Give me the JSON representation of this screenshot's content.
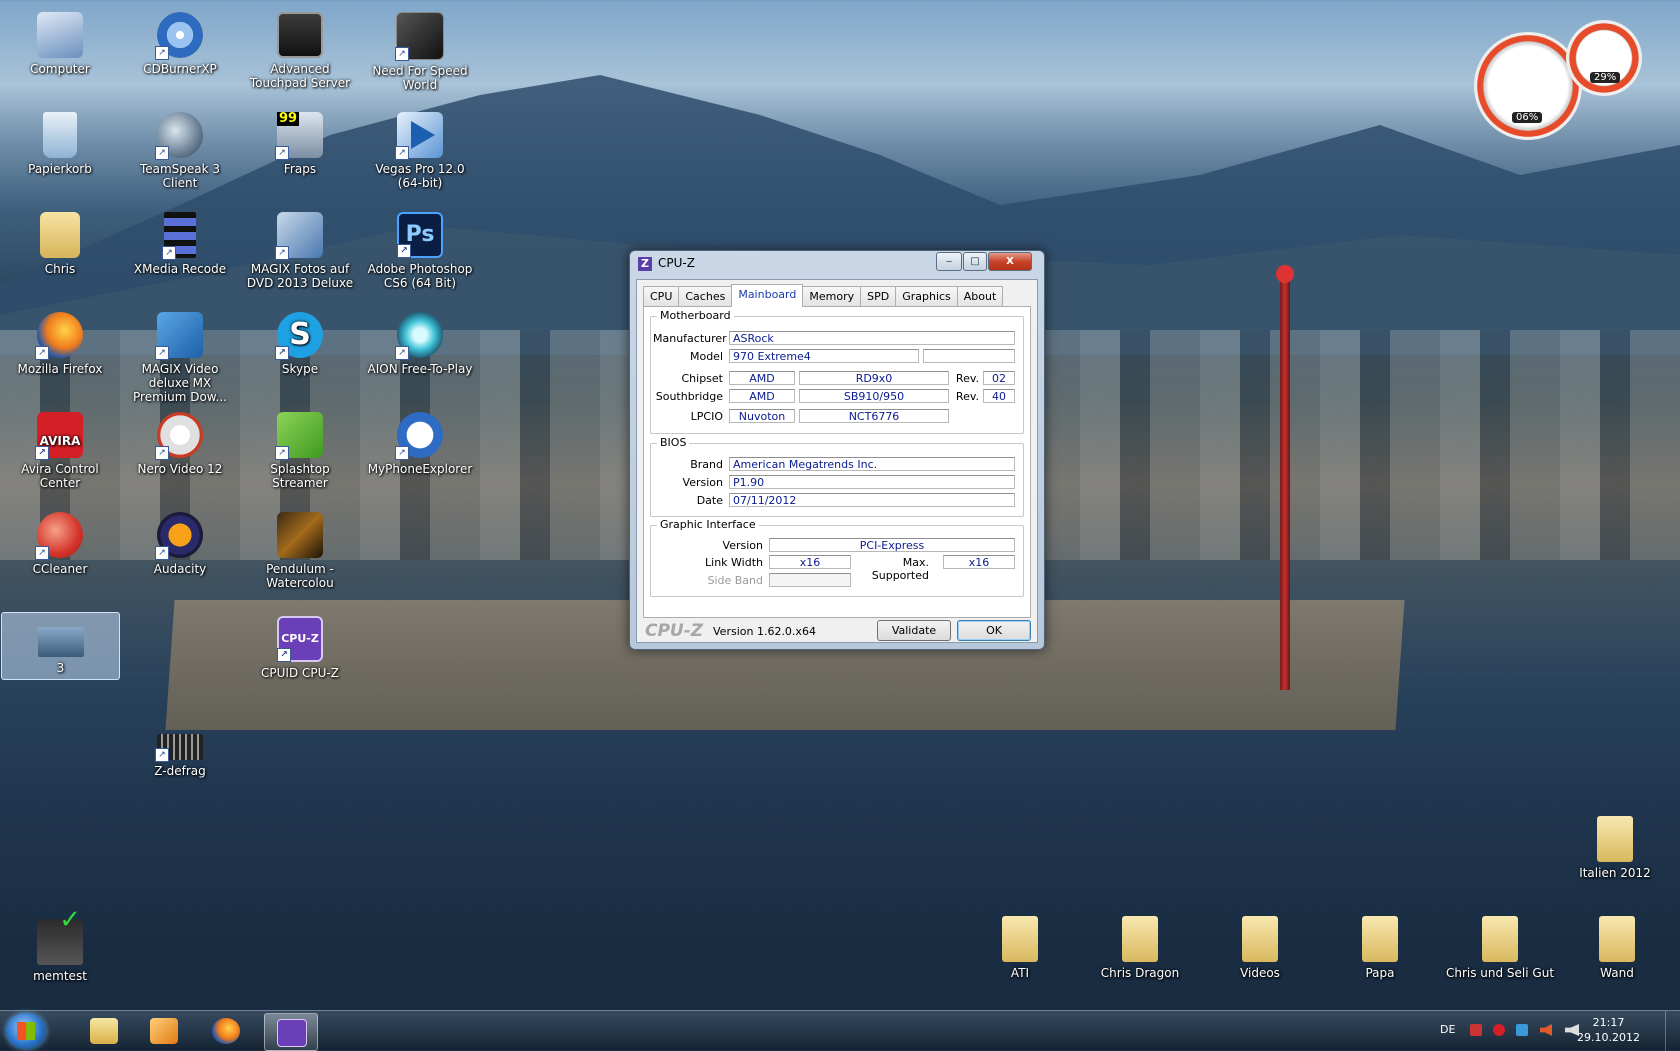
{
  "desktop": {
    "icons": [
      {
        "label": "Computer"
      },
      {
        "label": "CDBurnerXP"
      },
      {
        "label": "Advanced Touchpad Server"
      },
      {
        "label": "Need For Speed World"
      },
      {
        "label": "Papierkorb"
      },
      {
        "label": "TeamSpeak 3 Client"
      },
      {
        "label": "Fraps"
      },
      {
        "label": "Vegas Pro 12.0 (64-bit)"
      },
      {
        "label": "Chris"
      },
      {
        "label": "XMedia Recode"
      },
      {
        "label": "MAGIX Fotos auf DVD 2013 Deluxe"
      },
      {
        "label": "Adobe Photoshop CS6 (64 Bit)"
      },
      {
        "label": "Mozilla Firefox"
      },
      {
        "label": "MAGIX Video deluxe MX Premium Dow..."
      },
      {
        "label": "Skype"
      },
      {
        "label": "AION Free-To-Play"
      },
      {
        "label": "Avira Control Center"
      },
      {
        "label": "Nero Video 12"
      },
      {
        "label": "Splashtop Streamer"
      },
      {
        "label": "MyPhoneExplorer"
      },
      {
        "label": "CCleaner"
      },
      {
        "label": "Audacity"
      },
      {
        "label": "Pendulum - Watercolou"
      },
      {
        "label": "3"
      },
      {
        "label": "CPUID CPU-Z"
      },
      {
        "label": "Z-defrag"
      },
      {
        "label": "memtest"
      },
      {
        "label": "Italien 2012"
      },
      {
        "label": "ATI"
      },
      {
        "label": "Chris Dragon"
      },
      {
        "label": "Videos"
      },
      {
        "label": "Papa"
      },
      {
        "label": "Chris und Seli Gut"
      },
      {
        "label": "Wand"
      }
    ]
  },
  "gadget": {
    "cpu": "06%",
    "memory": "29%"
  },
  "cpuz": {
    "title": "CPU-Z",
    "tabs": [
      "CPU",
      "Caches",
      "Mainboard",
      "Memory",
      "SPD",
      "Graphics",
      "About"
    ],
    "active_tab": "Mainboard",
    "motherboard": {
      "group": "Motherboard",
      "manufacturer_label": "Manufacturer",
      "manufacturer": "ASRock",
      "model_label": "Model",
      "model": "970 Extreme4",
      "chipset_label": "Chipset",
      "chipset_vendor": "AMD",
      "chipset": "RD9x0",
      "rev_label": "Rev.",
      "chipset_rev": "02",
      "southbridge_label": "Southbridge",
      "southbridge_vendor": "AMD",
      "southbridge": "SB910/950",
      "southbridge_rev": "40",
      "lpcio_label": "LPCIO",
      "lpcio_vendor": "Nuvoton",
      "lpcio": "NCT6776"
    },
    "bios": {
      "group": "BIOS",
      "brand_label": "Brand",
      "brand": "American Megatrends Inc.",
      "version_label": "Version",
      "version": "P1.90",
      "date_label": "Date",
      "date": "07/11/2012"
    },
    "graphic_interface": {
      "group": "Graphic Interface",
      "version_label": "Version",
      "version": "PCI-Express",
      "link_width_label": "Link Width",
      "link_width": "x16",
      "max_supported_label": "Max. Supported",
      "max_supported": "x16",
      "side_band_label": "Side Band",
      "side_band": ""
    },
    "footer": {
      "brand": "CPU-Z",
      "version": "Version 1.62.0.x64",
      "validate": "Validate",
      "ok": "OK"
    },
    "window_buttons": {
      "minimize": "‒",
      "maximize": "□",
      "close": "X"
    }
  },
  "taskbar": {
    "language": "DE",
    "time": "21:17",
    "date": "29.10.2012"
  }
}
